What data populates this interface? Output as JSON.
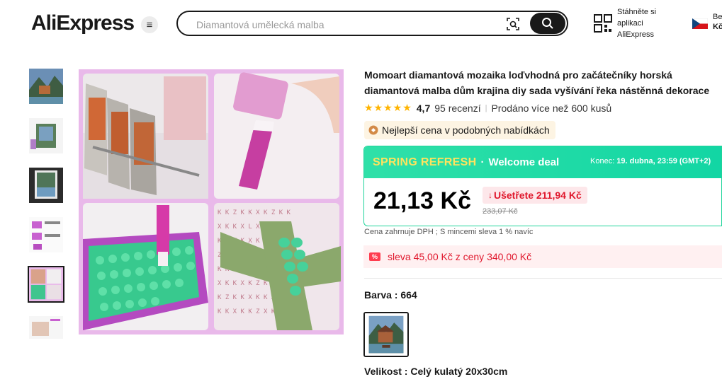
{
  "header": {
    "logo": "AliExpress",
    "search_placeholder": "Diamantová umělecká malba",
    "app_promo": [
      "Stáhněte si",
      "aplikaci",
      "AliExpress"
    ],
    "lang_line1": "Be",
    "lang_line2": "Kč"
  },
  "product": {
    "title": "Momoart diamantová mozaika loďvhodná pro začátečníky horská diamantová malba dům krajina diy sada vyšívání řeka nástěnná dekorace",
    "rating": "4,7",
    "reviews": "95 recenzí",
    "separator": "|",
    "sold": "Prodáno více než 600 kusů",
    "best_price": "Nejlepší cena v podobných nabídkách"
  },
  "deal": {
    "brand": "SPRING REFRESH",
    "dot": "·",
    "welcome": "Welcome deal",
    "ends_label": "Konec:",
    "ends_value": "19. dubna, 23:59 (GMT+2)",
    "price": "21,13 Kč",
    "save": "Ušetřete 211,94 Kč",
    "old_price": "233,07 Kč"
  },
  "vat_note": "Cena zahrnuje DPH ; S mincemi sleva 1 % navíc",
  "coupon": "sleva 45,00 Kč z ceny 340,00 Kč",
  "color_label": "Barva : 664",
  "size_label": "Velikost : Celý kulatý 20x30cm",
  "colors": {
    "accent_red": "#e0182d",
    "deal_green": "#1ed49a",
    "star": "#ffb400"
  }
}
